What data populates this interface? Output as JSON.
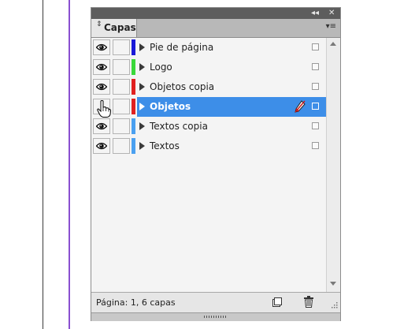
{
  "panel": {
    "titlebar": {
      "collapse_glyph": "◂◂",
      "close_glyph": "✕"
    },
    "tab": {
      "arrows_glyph": "⇕",
      "label": "Capas"
    },
    "menu_glyph": "▾≡"
  },
  "layers": [
    {
      "name": "Pie de página",
      "color": "#1a1ad8",
      "visible": true,
      "selected": false
    },
    {
      "name": "Logo",
      "color": "#3ad83a",
      "visible": true,
      "selected": false
    },
    {
      "name": "Objetos copia",
      "color": "#e02020",
      "visible": true,
      "selected": false
    },
    {
      "name": "Objetos",
      "color": "#e02020",
      "visible": false,
      "selected": true
    },
    {
      "name": "Textos copia",
      "color": "#4aa0f0",
      "visible": true,
      "selected": false
    },
    {
      "name": "Textos",
      "color": "#4aa0f0",
      "visible": true,
      "selected": false
    }
  ],
  "footer": {
    "status": "Página: 1, 6 capas"
  },
  "icons": {
    "eye": "eye-icon",
    "pen": "pen-icon",
    "new_layer": "new-layer-icon",
    "trash": "trash-icon",
    "cursor": "hand-cursor-icon"
  }
}
